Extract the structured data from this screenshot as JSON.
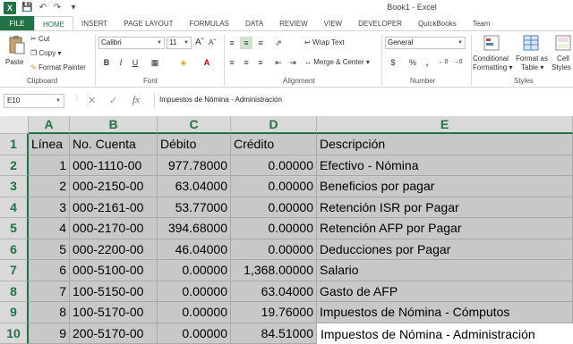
{
  "window": {
    "title": "Book1 - Excel",
    "app_logo": "X"
  },
  "tabs": [
    "FILE",
    "HOME",
    "INSERT",
    "PAGE LAYOUT",
    "FORMULAS",
    "DATA",
    "REVIEW",
    "VIEW",
    "DEVELOPER",
    "QuickBooks",
    "Team"
  ],
  "ribbon": {
    "clipboard": {
      "paste": "Paste",
      "cut": "Cut",
      "copy": "Copy",
      "format_painter": "Format Painter",
      "label": "Clipboard"
    },
    "font": {
      "name": "Calibri",
      "size": "11",
      "bold": "B",
      "italic": "I",
      "underline": "U",
      "label": "Font"
    },
    "alignment": {
      "wrap_text": "Wrap Text",
      "merge_center": "Merge & Center",
      "label": "Alignment"
    },
    "number": {
      "format": "General",
      "currency": "$",
      "percent": "%",
      "comma": ",",
      "label": "Number"
    },
    "styles": {
      "conditional": "Conditional",
      "formatting": "Formatting",
      "format_as": "Format as",
      "table": "Table",
      "cell": "Cell",
      "styles_btn": "Styles",
      "label": "Styles"
    }
  },
  "formula_bar": {
    "name_box": "E10",
    "fx": "fx",
    "content": "Impuestos de Nómina - Administración"
  },
  "sheet": {
    "columns": [
      "A",
      "B",
      "C",
      "D",
      "E"
    ],
    "rows": [
      "1",
      "2",
      "3",
      "4",
      "5",
      "6",
      "7",
      "8",
      "9",
      "10"
    ],
    "header": [
      "Línea",
      "No. Cuenta",
      "Débito",
      "Crédito",
      "Descripción"
    ],
    "data": [
      [
        "1",
        "000-1110-00",
        "977.78000",
        "0.00000",
        "Efectivo - Nómina"
      ],
      [
        "2",
        "000-2150-00",
        "63.04000",
        "0.00000",
        "Beneficios por pagar"
      ],
      [
        "3",
        "000-2161-00",
        "53.77000",
        "0.00000",
        "Retención ISR por Pagar"
      ],
      [
        "4",
        "000-2170-00",
        "394.68000",
        "0.00000",
        "Retención AFP por Pagar"
      ],
      [
        "5",
        "000-2200-00",
        "46.04000",
        "0.00000",
        "Deducciones por Pagar"
      ],
      [
        "6",
        "000-5100-00",
        "0.00000",
        "1,368.00000",
        "Salario"
      ],
      [
        "7",
        "100-5150-00",
        "0.00000",
        "63.04000",
        "Gasto de AFP"
      ],
      [
        "8",
        "100-5170-00",
        "0.00000",
        "19.76000",
        "Impuestos de Nómina - Cómputos"
      ],
      [
        "9",
        "200-5170-00",
        "0.00000",
        "84.51000",
        "Impuestos de Nómina - Administración"
      ]
    ]
  },
  "colors": {
    "excel_green": "#217346",
    "selection_gray": "#c8c8c8"
  }
}
